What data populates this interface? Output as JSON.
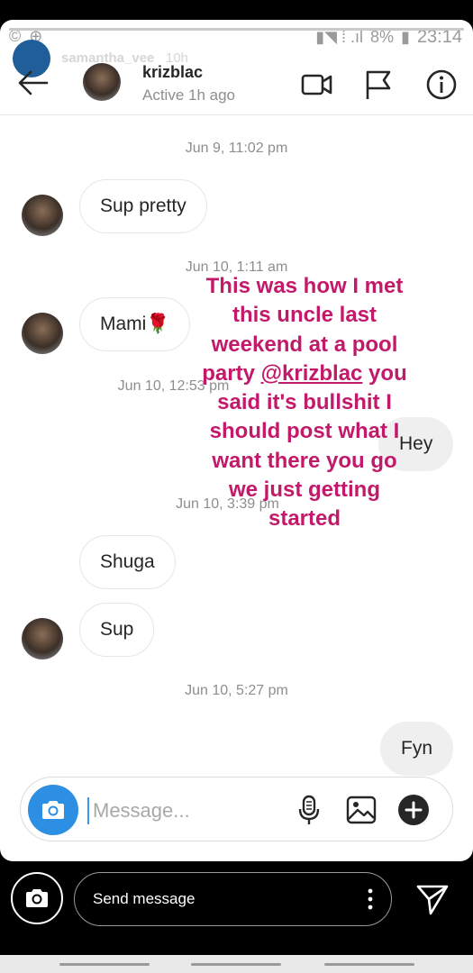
{
  "status_bar": {
    "left_icons": "© ⊕",
    "battery": "8%",
    "time": "23:14"
  },
  "story": {
    "username": "samantha_vee",
    "age": "10h",
    "progress": 1.0
  },
  "header": {
    "contact_name": "krizblac",
    "status": "Active 1h ago"
  },
  "messages": [
    {
      "type": "timestamp",
      "text": "Jun 9, 11:02 pm"
    },
    {
      "type": "received",
      "text": "Sup pretty"
    },
    {
      "type": "timestamp",
      "text": "Jun 10, 1:11 am"
    },
    {
      "type": "received",
      "text": "Mami🌹"
    },
    {
      "type": "timestamp",
      "text": "Jun 10, 12:53 pm"
    },
    {
      "type": "sent",
      "text": "Hey"
    },
    {
      "type": "timestamp",
      "text": "Jun 10, 3:39 pm"
    },
    {
      "type": "received",
      "text": "Shuga"
    },
    {
      "type": "received",
      "text": "Sup"
    },
    {
      "type": "timestamp",
      "text": "Jun 10, 5:27 pm"
    },
    {
      "type": "sent",
      "text": "Fyn"
    }
  ],
  "caption": {
    "before": "This was how I met this  uncle last weekend at a pool party ",
    "mention": "@krizblac",
    "after": "  you said it's bullshit I should  post what I want there you go we just getting started"
  },
  "composer": {
    "placeholder": "Message..."
  },
  "reply_bar": {
    "label": "Send message"
  },
  "colors": {
    "caption": "#c3196a",
    "camera_button": "#2d8fe3"
  }
}
